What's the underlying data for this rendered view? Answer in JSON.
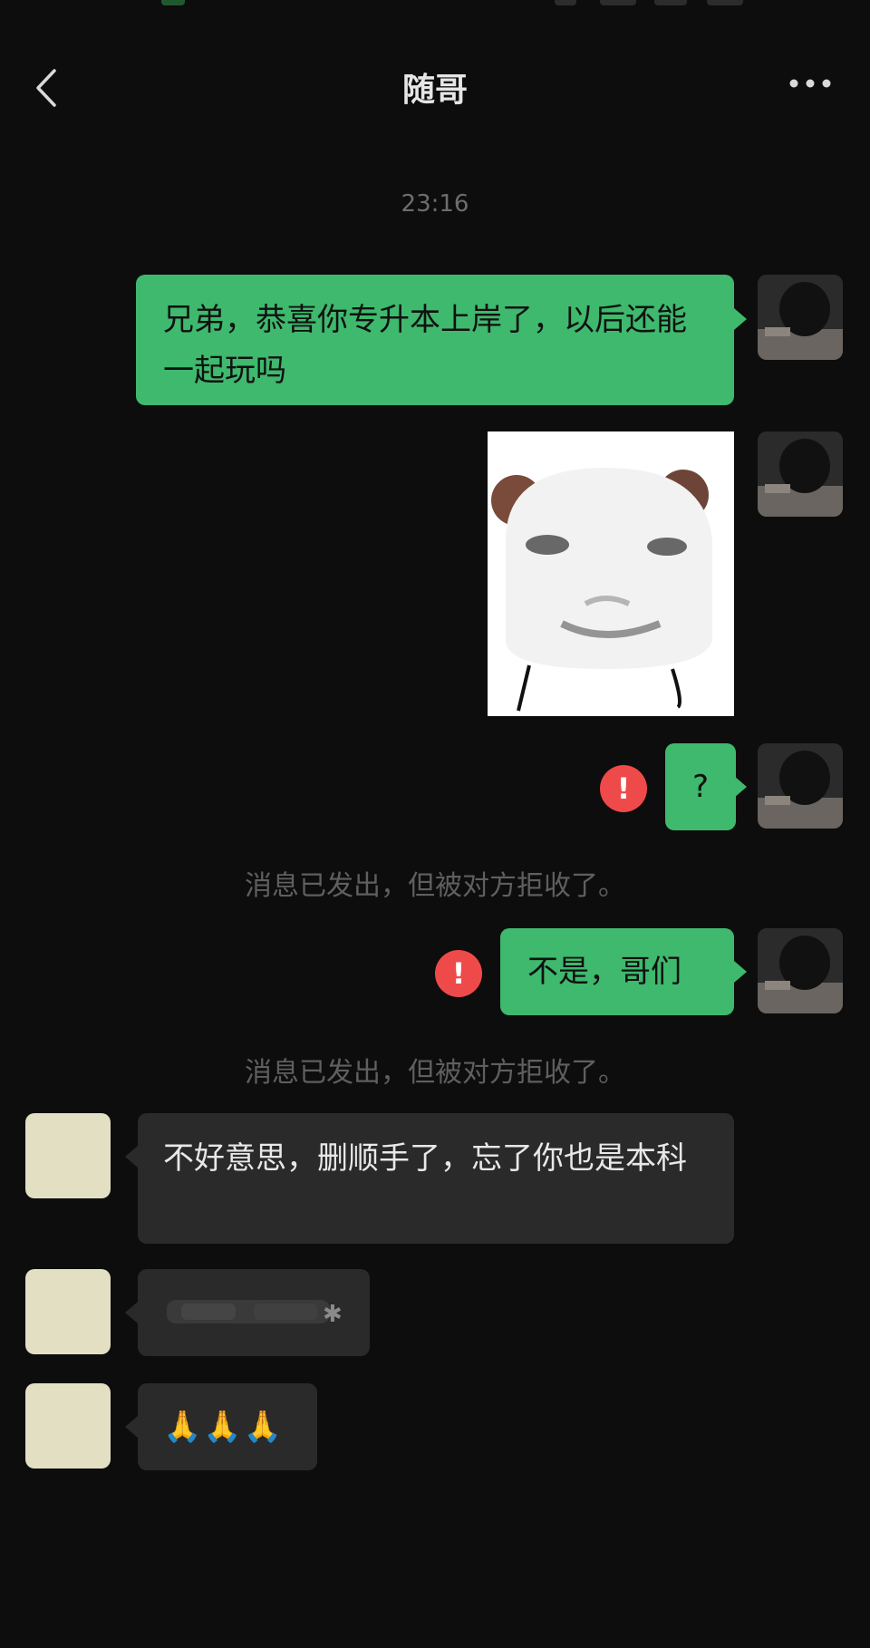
{
  "header": {
    "title": "随哥"
  },
  "time": "23:16",
  "messages": {
    "m1": "兄弟，恭喜你专升本上岸了，以后还能一起玩吗",
    "m3": "?",
    "m4": "不是，哥们",
    "m5": "不好意思，删顺手了，忘了你也是本科",
    "m7": "🙏🙏🙏"
  },
  "error_badge": "!",
  "rejected_note": "消息已发出，但被对方拒收了。",
  "colors": {
    "background": "#0d0d0d",
    "sent_bubble": "#3eb96d",
    "received_bubble": "#2a2a2a",
    "error": "#ef4a4a",
    "system_text": "#5f5f5f"
  },
  "icons": [
    "back-icon",
    "more-icon",
    "error-icon"
  ]
}
